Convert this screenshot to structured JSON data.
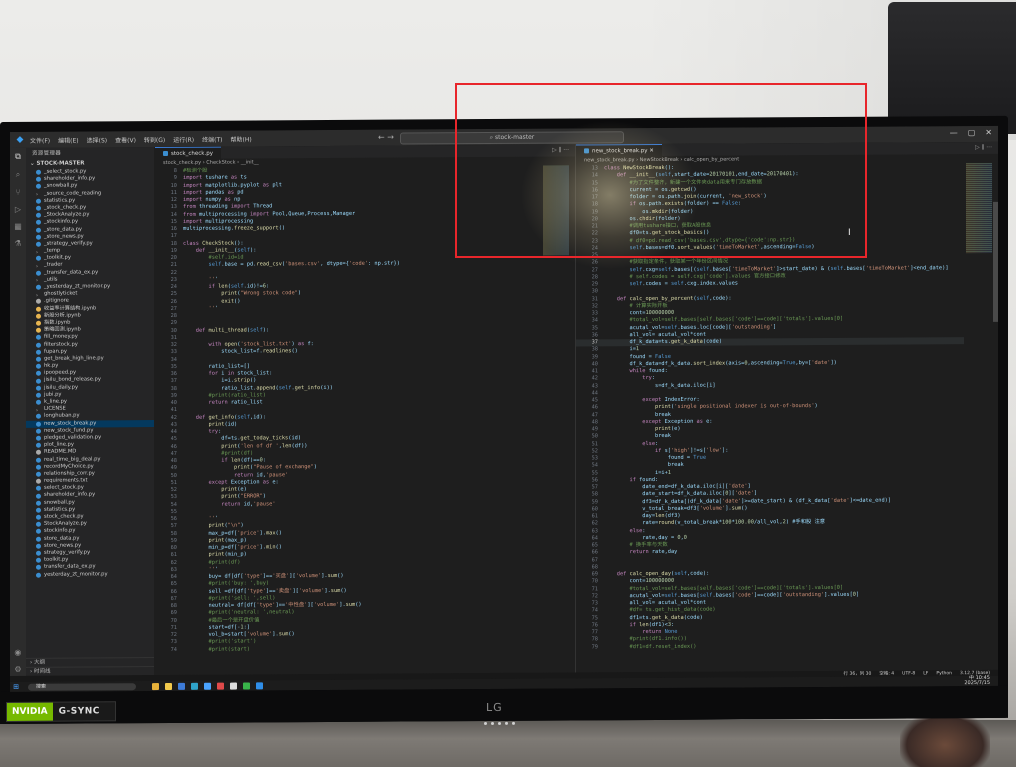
{
  "window": {
    "menu": [
      "文件(F)",
      "编辑(E)",
      "选择(S)",
      "查看(V)",
      "转到(G)",
      "运行(R)",
      "终端(T)",
      "帮助(H)"
    ],
    "command_center": "stock-master"
  },
  "sidebar": {
    "title": "资源管理器",
    "root": "STOCK-MASTER",
    "files": [
      "_select_stock.py",
      "shareholder_info.py",
      "_snowball.py",
      "_source_code_reading",
      "statistics.py",
      "_stock_check.py",
      "_StockAnalyze.py",
      "_stockinfo.py",
      "_store_data.py",
      "_store_news.py",
      "_strategy_verify.py",
      "_temp",
      "_toolkit.py",
      "_trader",
      "_transfer_data_ex.py",
      "_utils",
      "_yesterday_zt_monitor.py",
      "ghostlyticket",
      ".gitignore",
      "收益率计算结构.ipynb",
      "新股分析.ipynb",
      "指数.ipynb",
      "策略回测.ipynb",
      "fill_money.py",
      "filterstock.py",
      "fupan.py",
      "get_break_high_line.py",
      "hk.py",
      "ipoopeed.py",
      "jisilu_bond_release.py",
      "jisilu_daily.py",
      "jubi.py",
      "k_line.py",
      "LICENSE",
      "longhuban.py",
      "new_stock_break.py",
      "new_stock_fund.py",
      "pledged_validation.py",
      "plot_line.py",
      "README.MD",
      "real_time_big_deal.py",
      "recordMyChoice.py",
      "relationship_corr.py",
      "requirements.txt",
      "select_stock.py",
      "shareholder_info.py",
      "snowball.py",
      "statistics.py",
      "stock_check.py",
      "StockAnalyze.py",
      "stockinfo.py",
      "store_data.py",
      "store_news.py",
      "strategy_verify.py",
      "toolkit.py",
      "transfer_data_ex.py",
      "yesterday_zt_monitor.py"
    ],
    "active_file": "new_stock_break.py",
    "footer": [
      "大纲",
      "时间线"
    ]
  },
  "left_editor": {
    "tab": "stock_check.py",
    "breadcrumb": "stock_check.py › CheckStock › __init__",
    "lines": [
      {
        "n": 8,
        "t": "#检测个股"
      },
      {
        "n": 9,
        "t": "import tushare as ts"
      },
      {
        "n": 10,
        "t": "import matplotlib.pyplot as plt"
      },
      {
        "n": 11,
        "t": "import pandas as pd"
      },
      {
        "n": 12,
        "t": "import numpy as np"
      },
      {
        "n": 13,
        "t": "from threading import Thread"
      },
      {
        "n": 14,
        "t": "from multiprocessing import Pool,Queue,Process,Manager"
      },
      {
        "n": 15,
        "t": "import multiprocessing"
      },
      {
        "n": 16,
        "t": "multiprocessing.freeze_support()"
      },
      {
        "n": 17,
        "t": ""
      },
      {
        "n": 18,
        "t": "class CheckStock():"
      },
      {
        "n": 19,
        "t": "    def __init__(self):"
      },
      {
        "n": 20,
        "t": "        #self.id=id"
      },
      {
        "n": 21,
        "t": "        self.base = pd.read_csv('bases.csv', dtype={'code': np.str})"
      },
      {
        "n": 22,
        "t": ""
      },
      {
        "n": 23,
        "t": "        '''"
      },
      {
        "n": 24,
        "t": "        if len(self.id)!=6:"
      },
      {
        "n": 25,
        "t": "            print(\"Wrong stock code\")"
      },
      {
        "n": 26,
        "t": "            exit()"
      },
      {
        "n": 27,
        "t": "        '''"
      },
      {
        "n": 28,
        "t": ""
      },
      {
        "n": 29,
        "t": ""
      },
      {
        "n": 30,
        "t": "    def multi_thread(self):"
      },
      {
        "n": 31,
        "t": ""
      },
      {
        "n": 32,
        "t": "        with open('stock_list.txt') as f:"
      },
      {
        "n": 33,
        "t": "            stock_list=f.readlines()"
      },
      {
        "n": 34,
        "t": ""
      },
      {
        "n": 35,
        "t": "        ratio_list=[]"
      },
      {
        "n": 36,
        "t": "        for i in stock_list:"
      },
      {
        "n": 37,
        "t": "            i=i.strip()"
      },
      {
        "n": 38,
        "t": "            ratio_list.append(self.get_info(i))"
      },
      {
        "n": 39,
        "t": "        #print(ratio_list)"
      },
      {
        "n": 40,
        "t": "        return ratio_list"
      },
      {
        "n": 41,
        "t": ""
      },
      {
        "n": 42,
        "t": "    def get_info(self,id):"
      },
      {
        "n": 43,
        "t": "        print(id)"
      },
      {
        "n": 44,
        "t": "        try:"
      },
      {
        "n": 45,
        "t": "            df=ts.get_today_ticks(id)"
      },
      {
        "n": 46,
        "t": "            print('len of df ',len(df))"
      },
      {
        "n": 47,
        "t": "            #print(df)"
      },
      {
        "n": 48,
        "t": "            if len(df)==0:"
      },
      {
        "n": 49,
        "t": "                print(\"Pause of exchange\")"
      },
      {
        "n": 50,
        "t": "                return id,'pause'"
      },
      {
        "n": 51,
        "t": "        except Exception as e:"
      },
      {
        "n": 52,
        "t": "            print(e)"
      },
      {
        "n": 53,
        "t": "            print(\"ERROR\")"
      },
      {
        "n": 54,
        "t": "            return id,'pause'"
      },
      {
        "n": 55,
        "t": ""
      },
      {
        "n": 56,
        "t": "        '''"
      },
      {
        "n": 57,
        "t": "        print(\"\\n\")"
      },
      {
        "n": 58,
        "t": "        max_p=df['price'].max()"
      },
      {
        "n": 59,
        "t": "        print(max_p)"
      },
      {
        "n": 60,
        "t": "        min_p=df['price'].min()"
      },
      {
        "n": 61,
        "t": "        print(min_p)"
      },
      {
        "n": 62,
        "t": "        #print(df)"
      },
      {
        "n": 63,
        "t": "        '''"
      },
      {
        "n": 64,
        "t": "        buy= df[df['type']=='买盘']['volume'].sum()"
      },
      {
        "n": 65,
        "t": "        #print('buy: ',buy)"
      },
      {
        "n": 66,
        "t": "        sell =df[df['type']=='卖盘']['volume'].sum()"
      },
      {
        "n": 67,
        "t": "        #print('sell: ',sell)"
      },
      {
        "n": 68,
        "t": "        neutral= df[df['type']=='中性盘']['volume'].sum()"
      },
      {
        "n": 69,
        "t": "        #print('neutral: ',neutral)"
      },
      {
        "n": 70,
        "t": "        #最后一个是开盘价值"
      },
      {
        "n": 71,
        "t": "        start=df[-1:]"
      },
      {
        "n": 72,
        "t": "        vol_b=start['volume'].sum()"
      },
      {
        "n": 73,
        "t": "        #print('start')"
      },
      {
        "n": 74,
        "t": "        #print(start)"
      }
    ]
  },
  "right_editor": {
    "tab": "new_stock_break.py",
    "breadcrumb": "new_stock_break.py › NewStockBreak › calc_open_by_percent",
    "lines": [
      {
        "n": 13,
        "t": "class NewStockBreak():"
      },
      {
        "n": 14,
        "t": "    def __init__(self,start_date=20170101,end_date=20170401):"
      },
      {
        "n": 15,
        "t": "        #为了文件整齐，新建一个文件夹data用来专门存放数据"
      },
      {
        "n": 16,
        "t": "        current = os.getcwd()"
      },
      {
        "n": 17,
        "t": "        folder = os.path.join(current, 'new_stock')"
      },
      {
        "n": 18,
        "t": "        if os.path.exists(folder) == False:"
      },
      {
        "n": 19,
        "t": "            os.mkdir(folder)"
      },
      {
        "n": 20,
        "t": "        os.chdir(folder)"
      },
      {
        "n": 21,
        "t": "        #调用tushare接口，获取A股信息"
      },
      {
        "n": 22,
        "t": "        df0=ts.get_stock_basics()"
      },
      {
        "n": 23,
        "t": "        # df0=pd.read_csv('bases.csv',dtype={'code':np.str})"
      },
      {
        "n": 24,
        "t": "        self.bases=df0.sort_values('timeToMarket',ascending=False)"
      },
      {
        "n": 25,
        "t": ""
      },
      {
        "n": 26,
        "t": "        #获取指定条件，获取某一个年份区间情况"
      },
      {
        "n": 27,
        "t": "        self.cxg=self.bases[(self.bases['timeToMarket']>start_date) & (self.bases['timeToMarket']<end_date)]"
      },
      {
        "n": 28,
        "t": "        # self.codes = self.cxg['code'].values 官方接口修改"
      },
      {
        "n": 29,
        "t": "        self.codes = self.cxg.index.values"
      },
      {
        "n": 30,
        "t": ""
      },
      {
        "n": 31,
        "t": "    def calc_open_by_percent(self,code):"
      },
      {
        "n": 32,
        "t": "        # 计算实际开板"
      },
      {
        "n": 33,
        "t": "        cont=100000000"
      },
      {
        "n": 34,
        "t": "        #total_vol=self.bases[self.bases['code']==code]['totals'].values[0]"
      },
      {
        "n": 35,
        "t": "        acutal_vol=self.bases.loc[code]['outstanding']"
      },
      {
        "n": 36,
        "t": "        all_vol= acutal_vol*cont"
      },
      {
        "n": 37,
        "t": "        df_k_data=ts.get_k_data(code)"
      },
      {
        "n": 38,
        "t": "        i=1"
      },
      {
        "n": 39,
        "t": "        found = False"
      },
      {
        "n": 40,
        "t": "        df_k_data=df_k_data.sort_index(axis=0,ascending=True,by=['date'])"
      },
      {
        "n": 41,
        "t": "        while found:"
      },
      {
        "n": 42,
        "t": "            try:"
      },
      {
        "n": 43,
        "t": "                s=df_k_data.iloc[i]"
      },
      {
        "n": 44,
        "t": ""
      },
      {
        "n": 45,
        "t": "            except IndexError:"
      },
      {
        "n": 46,
        "t": "                print('single positional indexer is out-of-bounds')"
      },
      {
        "n": 47,
        "t": "                break"
      },
      {
        "n": 48,
        "t": "            except Exception as e:"
      },
      {
        "n": 49,
        "t": "                print(e)"
      },
      {
        "n": 50,
        "t": "                break"
      },
      {
        "n": 51,
        "t": "            else:"
      },
      {
        "n": 52,
        "t": "                if s['high']!=s['low']:"
      },
      {
        "n": 53,
        "t": "                    found = True"
      },
      {
        "n": 54,
        "t": "                    break"
      },
      {
        "n": 55,
        "t": "                i=i+1"
      },
      {
        "n": 56,
        "t": "        if found:"
      },
      {
        "n": 57,
        "t": "            date_end=df_k_data.iloc[i]['date']"
      },
      {
        "n": 58,
        "t": "            date_start=df_k_data.iloc[0]['date']"
      },
      {
        "n": 59,
        "t": "            df3=df_k_data[(df_k_data['date']>=date_start) & (df_k_data['date']<=date_end)]"
      },
      {
        "n": 60,
        "t": "            v_total_break=df3['volume'].sum()"
      },
      {
        "n": 61,
        "t": "            day=len(df3)"
      },
      {
        "n": 62,
        "t": "            rate=round(v_total_break*100*100.00/all_vol,2) #手和股 注意"
      },
      {
        "n": 63,
        "t": "        else:"
      },
      {
        "n": 64,
        "t": "            rate,day = 0,0"
      },
      {
        "n": 65,
        "t": "        # 换手率与天数"
      },
      {
        "n": 66,
        "t": "        return rate,day"
      },
      {
        "n": 67,
        "t": ""
      },
      {
        "n": 68,
        "t": ""
      },
      {
        "n": 69,
        "t": "    def calc_open_day(self,code):"
      },
      {
        "n": 70,
        "t": "        cont=100000000"
      },
      {
        "n": 71,
        "t": "        #total_vol=self.bases[self.bases['code']==code]['totals'].values[0]"
      },
      {
        "n": 72,
        "t": "        acutal_vol=self.bases[self.bases['code']==code]['outstanding'].values[0]"
      },
      {
        "n": 73,
        "t": "        all_vol= acutal_vol*cont"
      },
      {
        "n": 74,
        "t": "        #df= ts.get_hist_data(code)"
      },
      {
        "n": 75,
        "t": "        df1=ts.get_k_data(code)"
      },
      {
        "n": 76,
        "t": "        if len(df1)<3:"
      },
      {
        "n": 77,
        "t": "            return None"
      },
      {
        "n": 78,
        "t": "        #print(df1.info())"
      },
      {
        "n": 79,
        "t": "        #df1=df.reset_index()"
      }
    ],
    "highlight_line": 37
  },
  "statusbar": {
    "position": "行 36，列 30",
    "spaces": "空格: 4",
    "encoding": "UTF-8",
    "eol": "LF",
    "language": "Python",
    "interpreter": "3.12.7 (base)"
  },
  "taskbar": {
    "search": "搜索",
    "time": "10:45",
    "date": "2025/7/15",
    "lang": "中"
  },
  "hardware": {
    "nvidia": "NVIDIA",
    "gsync": "G-SYNC",
    "brand": "LG"
  },
  "colors": {
    "annotation_box": "#e8262b",
    "editor_bg": "#1e1e1e",
    "accent": "#3a7bd5"
  }
}
